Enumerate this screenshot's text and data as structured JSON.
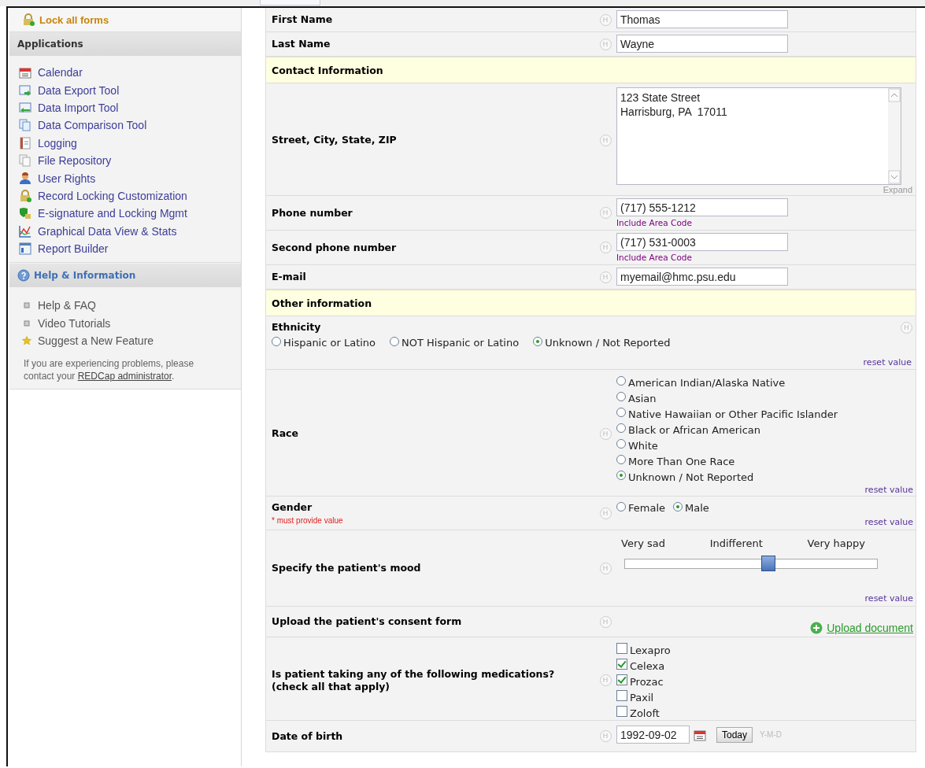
{
  "sidebar": {
    "top_link": {
      "label": "Lock all forms"
    },
    "applications": {
      "title": "Applications",
      "items": [
        {
          "label": "Calendar"
        },
        {
          "label": "Data Export Tool"
        },
        {
          "label": "Data Import Tool"
        },
        {
          "label": "Data Comparison Tool"
        },
        {
          "label": "Logging"
        },
        {
          "label": "File Repository"
        },
        {
          "label": "User Rights"
        },
        {
          "label": "Record Locking Customization"
        },
        {
          "label": "E-signature and Locking Mgmt"
        },
        {
          "label": "Graphical Data View & Stats"
        },
        {
          "label": "Report Builder"
        }
      ]
    },
    "help": {
      "title": "Help & Information",
      "items": [
        {
          "label": "Help & FAQ",
          "kind": "bullet"
        },
        {
          "label": "Video Tutorials",
          "kind": "bullet"
        },
        {
          "label": "Suggest a New Feature",
          "kind": "star"
        }
      ],
      "note": {
        "text": "If you are experiencing problems, please contact your",
        "link": "REDCap administrator",
        "end": "."
      }
    }
  },
  "form": {
    "rows": [
      {
        "kind": "text",
        "label": "First Name",
        "hint": "H",
        "value": "Thomas"
      },
      {
        "kind": "text",
        "label": "Last Name",
        "hint": "H",
        "value": "Wayne"
      },
      {
        "kind": "header",
        "label": "Contact Information"
      },
      {
        "kind": "textarea",
        "label": "Street, City, State, ZIP",
        "hint": "H",
        "value": "123 State Street\nHarrisburg, PA  17011",
        "expand": "Expand"
      },
      {
        "kind": "text",
        "label": "Phone number",
        "hint": "H",
        "value": "(717) 555-1212",
        "note": "Include Area Code"
      },
      {
        "kind": "text",
        "label": "Second phone number",
        "hint": "H",
        "value": "(717) 531-0003",
        "note": "Include Area Code"
      },
      {
        "kind": "text",
        "label": "E-mail",
        "hint": "H",
        "value": "myemail@hmc.psu.edu"
      },
      {
        "kind": "header",
        "label": "Other information"
      },
      {
        "kind": "radio_below",
        "label": "Ethnicity",
        "hint": "H",
        "reset": "reset value",
        "options": [
          {
            "label": "Hispanic or Latino",
            "selected": false
          },
          {
            "label": "NOT Hispanic or Latino",
            "selected": false
          },
          {
            "label": "Unknown / Not Reported",
            "selected": true
          }
        ]
      },
      {
        "kind": "radio_stacked",
        "label": "Race",
        "hint": "H",
        "reset": "reset value",
        "options": [
          {
            "label": "American Indian/Alaska Native",
            "selected": false
          },
          {
            "label": "Asian",
            "selected": false
          },
          {
            "label": "Native Hawaiian or Other Pacific Islander",
            "selected": false
          },
          {
            "label": "Black or African American",
            "selected": false
          },
          {
            "label": "White",
            "selected": false
          },
          {
            "label": "More Than One Race",
            "selected": false
          },
          {
            "label": "Unknown / Not Reported",
            "selected": true
          }
        ]
      },
      {
        "kind": "radio_inline",
        "label": "Gender",
        "hint": "H",
        "required": "* must provide value",
        "reset": "reset value",
        "options": [
          {
            "label": "Female",
            "selected": false
          },
          {
            "label": "Male",
            "selected": true
          }
        ]
      },
      {
        "kind": "slider",
        "label": "Specify the patient's mood",
        "hint": "H",
        "scale": [
          "Very sad",
          "Indifferent",
          "Very happy"
        ],
        "level": 0.57,
        "reset": "reset value"
      },
      {
        "kind": "upload",
        "label": "Upload the patient's consent form",
        "hint": "H",
        "link": "Upload document"
      },
      {
        "kind": "checkbox",
        "label": "Is patient taking any of the following medications?\n(check all that apply)",
        "hint": "H",
        "options": [
          {
            "label": "Lexapro",
            "checked": false
          },
          {
            "label": "Celexa",
            "checked": true
          },
          {
            "label": "Prozac",
            "checked": true
          },
          {
            "label": "Paxil",
            "checked": false
          },
          {
            "label": "Zoloft",
            "checked": false
          }
        ]
      },
      {
        "kind": "date",
        "label": "Date of birth",
        "hint": "H",
        "value": "1992-09-02",
        "button": "Today",
        "format": "Y-M-D"
      }
    ]
  }
}
